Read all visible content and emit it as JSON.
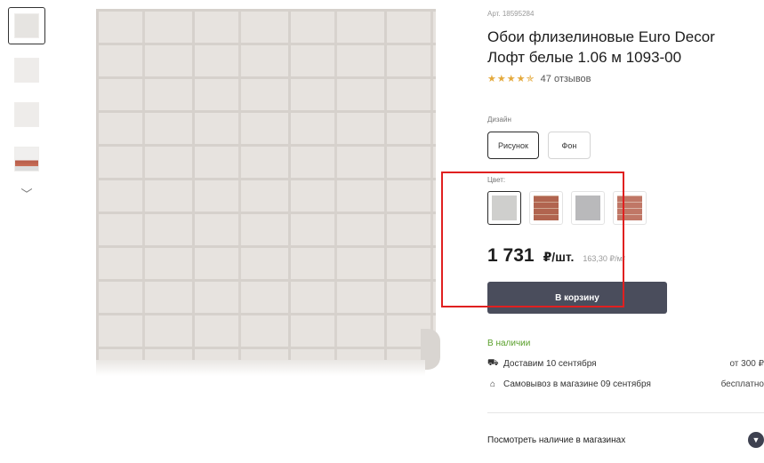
{
  "product": {
    "sku": "Арт. 18595284",
    "title": "Обои флизелиновые Euro Decor Лофт белые 1.06 м 1093-00",
    "stars": "★★★★✯",
    "reviews": "47 отзывов"
  },
  "design": {
    "label": "Дизайн",
    "options": [
      "Рисунок",
      "Фон"
    ],
    "selected": "Рисунок"
  },
  "color": {
    "label": "Цвет:",
    "selected_index": 0
  },
  "price": {
    "value": "1 731",
    "unit": "₽/шт.",
    "per_m2": "163,30 ₽/м²"
  },
  "cart": {
    "label": "В корзину"
  },
  "availability": {
    "status": "В наличии",
    "delivery_text": "Доставим 10 сентября",
    "delivery_price": "от 300 ₽",
    "pickup_text": "Самовывоз в магазине 09 сентября",
    "pickup_price": "бесплатно"
  },
  "stores": {
    "label": "Посмотреть наличие в магазинах"
  },
  "icons": {
    "thumb_down": "chevron-down-icon",
    "delivery": "truck-icon",
    "pickup": "bag-icon",
    "stores": "chevron-down-icon"
  },
  "colors": {
    "accent": "#4a4d5c",
    "in_stock": "#5aa02c",
    "star": "#e4a93c",
    "highlight": "#e02020"
  }
}
